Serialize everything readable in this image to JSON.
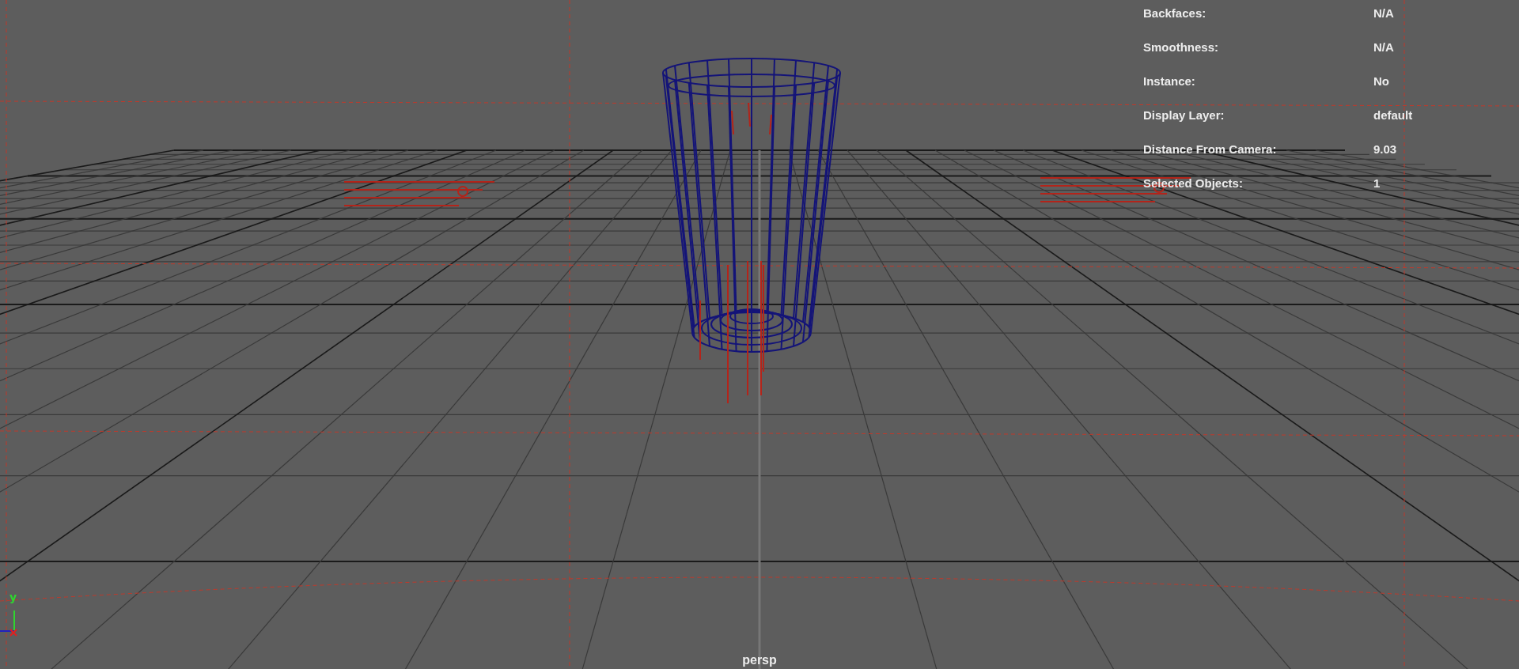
{
  "viewport": {
    "camera_label": "persp",
    "axis_label": "y",
    "hud": [
      {
        "label": "Backfaces:",
        "value": "N/A"
      },
      {
        "label": "Smoothness:",
        "value": "N/A"
      },
      {
        "label": "Instance:",
        "value": "No"
      },
      {
        "label": "Display Layer:",
        "value": "default"
      },
      {
        "label": "Distance From Camera:",
        "value": "9.03"
      },
      {
        "label": "Selected Objects:",
        "value": "1"
      }
    ]
  }
}
